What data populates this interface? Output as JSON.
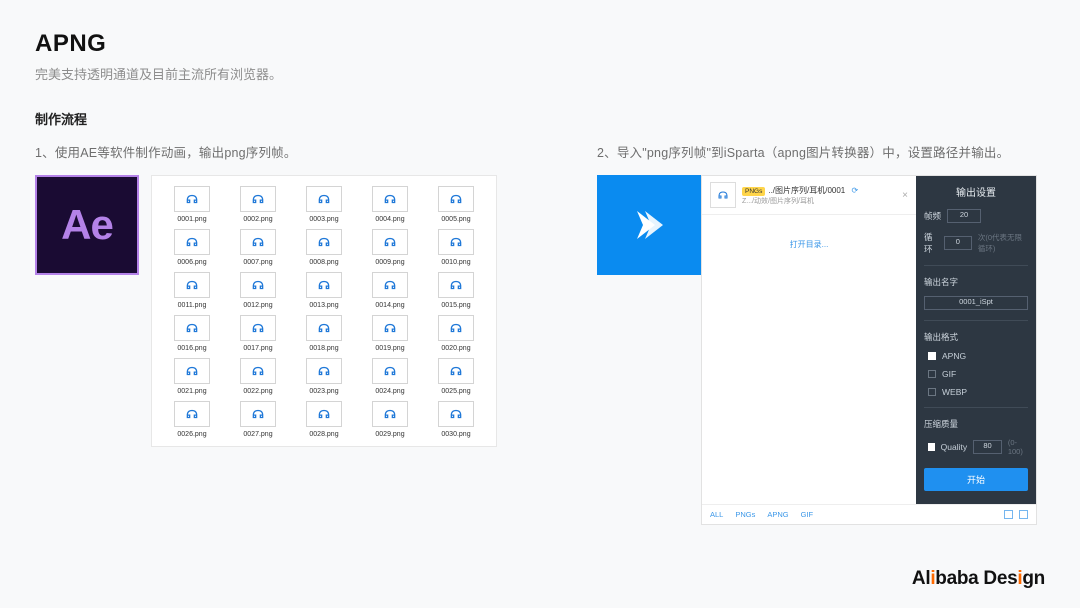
{
  "title": "APNG",
  "subtitle": "完美支持透明通道及目前主流所有浏览器。",
  "section_label": "制作流程",
  "step1_text": "1、使用AE等软件制作动画，输出png序列帧。",
  "step2_text": "2、导入\"png序列帧\"到iSparta（apng图片转换器）中，设置路径并输出。",
  "ae_logo": "Ae",
  "files": [
    "0001.png",
    "0002.png",
    "0003.png",
    "0004.png",
    "0005.png",
    "0006.png",
    "0007.png",
    "0008.png",
    "0009.png",
    "0010.png",
    "0011.png",
    "0012.png",
    "0013.png",
    "0014.png",
    "0015.png",
    "0016.png",
    "0017.png",
    "0018.png",
    "0019.png",
    "0020.png",
    "0021.png",
    "0022.png",
    "0023.png",
    "0024.png",
    "0025.png",
    "0026.png",
    "0027.png",
    "0028.png",
    "0029.png",
    "0030.png"
  ],
  "isparta": {
    "item_tag": "PNGs",
    "item_title": "../图片序列/耳机/0001",
    "item_sub": "Z.../动效/图片序列/耳机",
    "drop_hint": "打开目录...",
    "footer": {
      "all": "ALL",
      "pngs": "PNGs",
      "apng": "APNG",
      "gif": "GIF"
    },
    "side": {
      "title": "输出设置",
      "fps_label": "帧频",
      "fps_value": "20",
      "loop_label": "循环",
      "loop_value": "0",
      "loop_hint": "次(0代表无限循环)",
      "name_label": "输出名字",
      "name_value": "0001_iSpt",
      "format_label": "输出格式",
      "fmt_apng": "APNG",
      "fmt_gif": "GIF",
      "fmt_webp": "WEBP",
      "quality_label": "压缩质量",
      "quality_name": "Quality",
      "quality_value": "80",
      "quality_hint": "(0-100)",
      "start": "开始"
    }
  },
  "brand_a": "Al",
  "brand_b": "baba Des",
  "brand_c": "gn",
  "brand_i1": "i",
  "brand_i2": "i"
}
